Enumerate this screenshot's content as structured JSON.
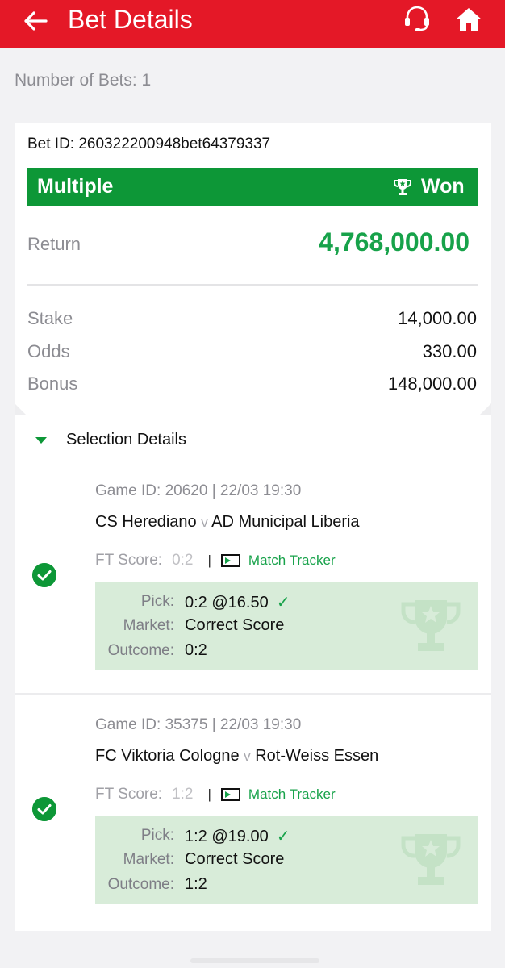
{
  "header": {
    "title": "Bet Details",
    "back_icon": "arrow-left-icon",
    "support_icon": "headset-icon",
    "home_icon": "home-icon",
    "bg_color": "#e41827"
  },
  "summary": {
    "number_of_bets": "Number of Bets: 1"
  },
  "bet": {
    "id_text": "Bet ID: 260322200948bet64379337",
    "type": "Multiple",
    "status": "Won",
    "status_icon": "trophy-icon",
    "status_color": "#0d9737",
    "return_label": "Return",
    "return_value": "4,768,000.00",
    "details": [
      {
        "label": "Stake",
        "value": "14,000.00"
      },
      {
        "label": "Odds",
        "value": "330.00"
      },
      {
        "label": "Bonus",
        "value": "148,000.00"
      }
    ]
  },
  "selection": {
    "title": "Selection Details",
    "matches": [
      {
        "game_meta": "Game ID: 20620 | 22/03 19:30",
        "home": "CS Herediano",
        "vs": "v",
        "away": "AD Municipal Liberia",
        "ft_label": "FT Score:",
        "ft_score": "0:2",
        "tracker": "Match Tracker",
        "pick_label": "Pick:",
        "pick_value": "0:2 @16.50",
        "market_label": "Market:",
        "market_value": "Correct Score",
        "outcome_label": "Outcome:",
        "outcome_value": "0:2",
        "result_icon": "check-circle-icon"
      },
      {
        "game_meta": "Game ID: 35375 | 22/03 19:30",
        "home": "FC Viktoria Cologne",
        "vs": "v",
        "away": "Rot-Weiss Essen",
        "ft_label": "FT Score:",
        "ft_score": "1:2",
        "tracker": "Match Tracker",
        "pick_label": "Pick:",
        "pick_value": "1:2 @19.00",
        "market_label": "Market:",
        "market_value": "Correct Score",
        "outcome_label": "Outcome:",
        "outcome_value": "1:2",
        "result_icon": "check-circle-icon"
      }
    ]
  },
  "accent_green": "#17a24a"
}
